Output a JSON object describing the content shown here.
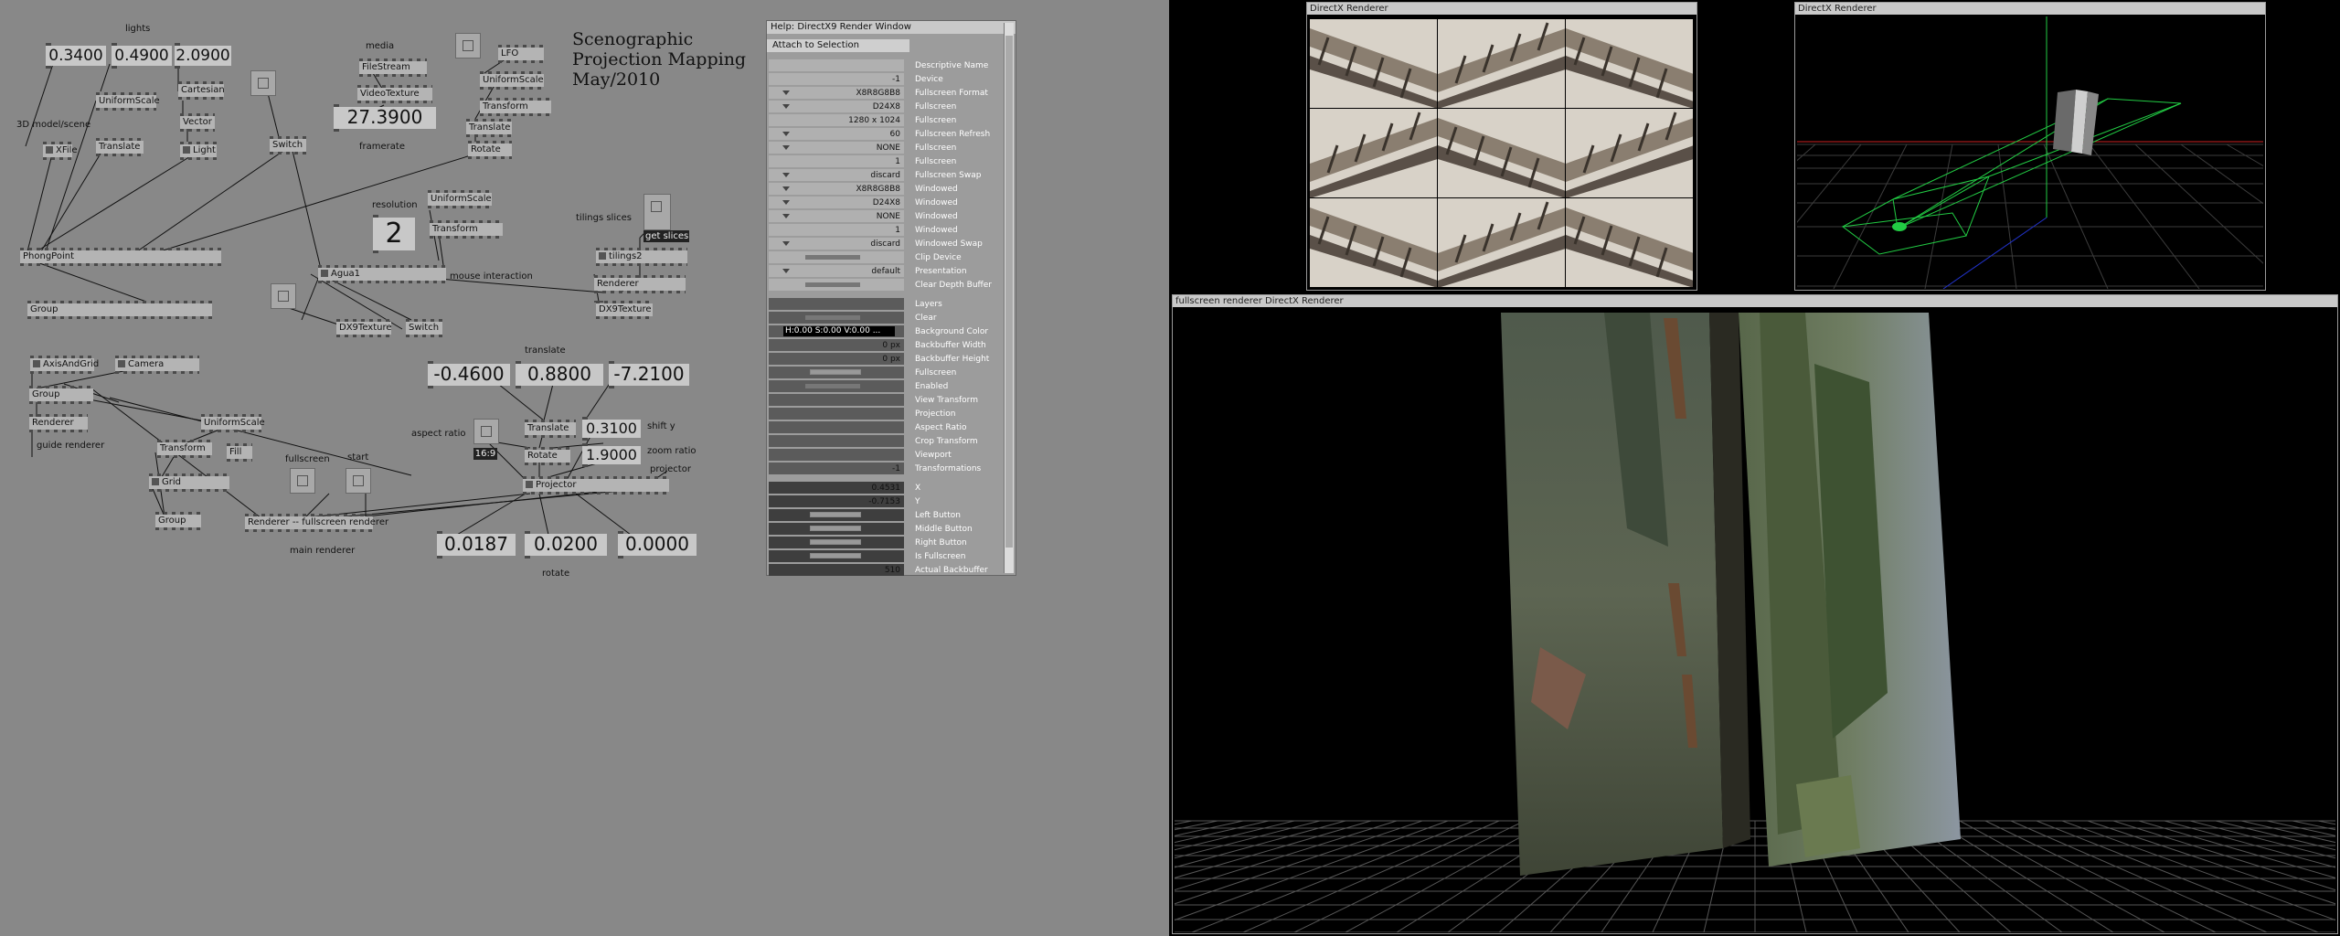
{
  "patch": {
    "title_lines": [
      "Scenographic",
      "Projection Mapping",
      "May/2010"
    ],
    "labels": {
      "lights": "lights",
      "model": "3D model/scene",
      "media": "media",
      "framerate": "framerate",
      "resolution": "resolution",
      "tilings_slices": "tilings slices",
      "mouse_interaction": "mouse interaction",
      "translate": "translate",
      "aspect_ratio": "aspect ratio",
      "shift_y": "shift y",
      "zoom_ratio": "zoom ratio",
      "projector": "projector",
      "fullscreen": "fullscreen",
      "start": "start",
      "guide_renderer": "guide renderer",
      "main_renderer": "main renderer",
      "rotate": "rotate"
    },
    "values": {
      "light_x": "0.3400",
      "light_y": "0.4900",
      "light_z": "2.0900",
      "framerate": "27.3900",
      "resolution": "2",
      "translate_x": "-0.4600",
      "translate_y": "0.8800",
      "translate_z": "-7.2100",
      "shift_y": "0.3100",
      "zoom_ratio": "1.9000",
      "rotate_x": "0.0187",
      "rotate_y": "0.0200",
      "rotate_z": "0.0000",
      "aspect": "16:9"
    },
    "nodes": {
      "cartesian": "Cartesian",
      "vector": "Vector",
      "light": "Light",
      "uniformscale1": "UniformScale",
      "xfile": "XFile",
      "translate1": "Translate",
      "switch1": "Switch",
      "filestream": "FileStream",
      "videotexture": "VideoTexture",
      "lfo": "LFO",
      "uniformscale2": "UniformScale",
      "transform1": "Transform",
      "translate2": "Translate",
      "rotate1": "Rotate",
      "phongpoint": "PhongPoint",
      "uniformscale3": "UniformScale",
      "transform2": "Transform",
      "agua": "Agua1",
      "get_slices": "get slices",
      "tilings": "tilings2",
      "renderer1": "Renderer",
      "dx9texture1": "DX9Texture",
      "group1": "Group",
      "dx9texture2": "DX9Texture",
      "switch2": "Switch",
      "axisandgrid": "AxisAndGrid",
      "camera": "Camera",
      "group2": "Group",
      "renderer2": "Renderer",
      "uniformscale4": "UniformScale",
      "transform3": "Transform",
      "fill": "Fill",
      "grid": "Grid",
      "group3": "Group",
      "translate3": "Translate",
      "rotate2": "Rotate",
      "projector": "Projector",
      "fs_renderer": "Renderer -- fullscreen renderer"
    }
  },
  "help": {
    "title": "Help: DirectX9 Render Window",
    "attach": "Attach to Selection",
    "pins": [
      {
        "value": "",
        "name": "Descriptive Name"
      },
      {
        "value": "-1",
        "name": "Device"
      },
      {
        "value": "X8R8G8B8",
        "name": "Fullscreen Format"
      },
      {
        "value": "D24X8",
        "name": "Fullscreen"
      },
      {
        "value": "1280 x 1024",
        "name": "Fullscreen"
      },
      {
        "value": "60",
        "name": "Fullscreen Refresh"
      },
      {
        "value": "NONE",
        "name": "Fullscreen"
      },
      {
        "value": "1",
        "name": "Fullscreen"
      },
      {
        "value": "discard",
        "name": "Fullscreen Swap"
      },
      {
        "value": "X8R8G8B8",
        "name": "Windowed"
      },
      {
        "value": "D24X8",
        "name": "Windowed"
      },
      {
        "value": "NONE",
        "name": "Windowed"
      },
      {
        "value": "1",
        "name": "Windowed"
      },
      {
        "value": "discard",
        "name": "Windowed Swap"
      },
      {
        "value": "",
        "name": "Clip Device"
      },
      {
        "value": "default",
        "name": "Presentation"
      },
      {
        "value": "",
        "name": "Clear Depth Buffer"
      },
      {
        "value": "",
        "name": "Layers"
      },
      {
        "value": "",
        "name": "Clear"
      },
      {
        "value": "H:0.00  S:0.00  V:0.00 ...",
        "name": "Background Color"
      },
      {
        "value": "0 px",
        "name": "Backbuffer Width"
      },
      {
        "value": "0 px",
        "name": "Backbuffer Height"
      },
      {
        "value": "",
        "name": "Fullscreen"
      },
      {
        "value": "",
        "name": "Enabled"
      },
      {
        "value": "",
        "name": "View Transform"
      },
      {
        "value": "",
        "name": "Projection"
      },
      {
        "value": "",
        "name": "Aspect Ratio"
      },
      {
        "value": "",
        "name": "Crop Transform"
      },
      {
        "value": "",
        "name": "Viewport"
      },
      {
        "value": "-1",
        "name": "Transformations"
      },
      {
        "value": "0.4531",
        "name": "X"
      },
      {
        "value": "-0.7153",
        "name": "Y"
      },
      {
        "value": "",
        "name": "Left Button"
      },
      {
        "value": "",
        "name": "Middle Button"
      },
      {
        "value": "",
        "name": "Right Button"
      },
      {
        "value": "",
        "name": "Is Fullscreen"
      },
      {
        "value": "510",
        "name": "Actual Backbuffer"
      }
    ]
  },
  "windows": {
    "dx1_title": "DirectX Renderer",
    "dx2_title": "DirectX Renderer",
    "fs_title": "fullscreen renderer  DirectX Renderer"
  },
  "colors": {
    "patch_bg": "#888888",
    "grid_green": "#22cc44",
    "axis_red": "#cc2222",
    "axis_blue": "#2233cc"
  }
}
